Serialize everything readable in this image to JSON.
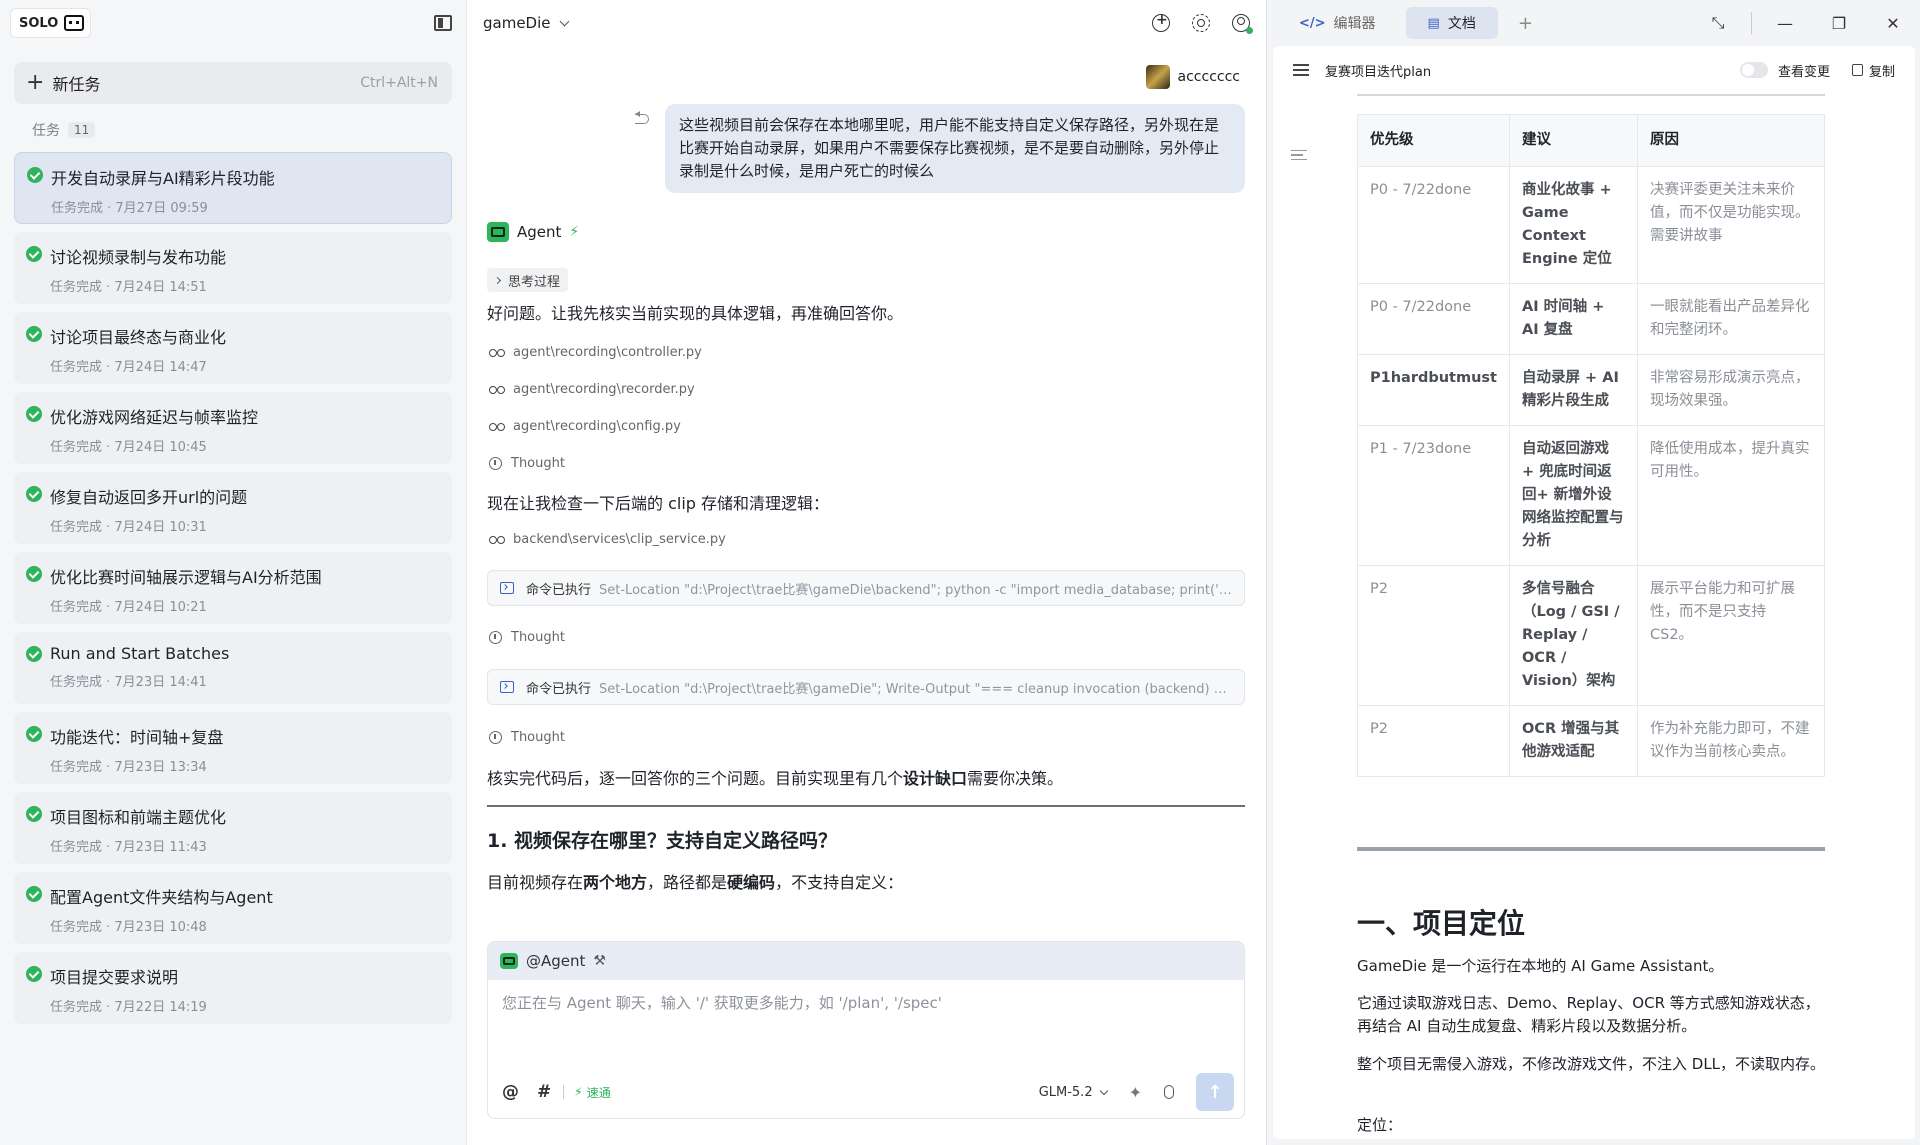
{
  "sidebar": {
    "badge": "SOLO",
    "new_task": {
      "label": "新任务",
      "shortcut": "Ctrl+Alt+N"
    },
    "tasks_label": "任务",
    "tasks_count": "11",
    "tasks": [
      {
        "title": "开发自动录屏与AI精彩片段功能",
        "meta": "任务完成 · 7月27日 09:59",
        "active": true
      },
      {
        "title": "讨论视频录制与发布功能",
        "meta": "任务完成 · 7月24日 14:51"
      },
      {
        "title": "讨论项目最终态与商业化",
        "meta": "任务完成 · 7月24日 14:47"
      },
      {
        "title": "优化游戏网络延迟与帧率监控",
        "meta": "任务完成 · 7月24日 10:45"
      },
      {
        "title": "修复自动返回多开url的问题",
        "meta": "任务完成 · 7月24日 10:31"
      },
      {
        "title": "优化比赛时间轴展示逻辑与AI分析范围",
        "meta": "任务完成 · 7月24日 10:21"
      },
      {
        "title": "Run and Start Batches",
        "meta": "任务完成 · 7月23日 14:41"
      },
      {
        "title": "功能迭代：时间轴+复盘",
        "meta": "任务完成 · 7月23日 13:34"
      },
      {
        "title": "项目图标和前端主题优化",
        "meta": "任务完成 · 7月23日 11:43"
      },
      {
        "title": "配置Agent文件夹结构与Agent",
        "meta": "任务完成 · 7月23日 10:48"
      },
      {
        "title": "项目提交要求说明",
        "meta": "任务完成 · 7月22日 14:19"
      }
    ]
  },
  "chat": {
    "project": "gameDie",
    "user": "accccccc",
    "user_message": "这些视频目前会保存在本地哪里呢，用户能不能支持自定义保存路径，另外现在是比赛开始自动录屏，如果用户不需要保存比赛视频，是不是要自动删除，另外停止录制是什么时候，是用户死亡的时候么",
    "agent_name": "Agent",
    "thinking_label": "思考过程",
    "reply_1": "好问题。让我先核实当前实现的具体逻辑，再准确回答你。",
    "files_1": [
      "agent\\recording\\controller.py",
      "agent\\recording\\recorder.py",
      "agent\\recording\\config.py"
    ],
    "thought_label": "Thought",
    "reply_2": "现在让我检查一下后端的 clip 存储和清理逻辑：",
    "file_2": "backend\\services\\clip_service.py",
    "cmd_done_label": "命令已执行",
    "cmd_1": "Set-Location \"d:\\Project\\trae比赛\\gameDie\\backend\"; python -c \"import media_database; print('CLIPS...",
    "cmd_2": "Set-Location \"d:\\Project\\trae比赛\\gameDie\"; Write-Output \"=== cleanup invocation (backend) ===\";...",
    "reply_3_a": "核实完代码后，逐一回答你的三个问题。目前实现里有几个",
    "reply_3_b": "设计缺口",
    "reply_3_c": "需要你决策。",
    "heading_1": "1. 视频保存在哪里？支持自定义路径吗？",
    "reply_4_a": "目前视频存在",
    "reply_4_b": "两个地方",
    "reply_4_c": "，路径都是",
    "reply_4_d": "硬编码",
    "reply_4_e": "，不支持自定义：",
    "input": {
      "mention": "@Agent",
      "placeholder": "您正在与 Agent 聊天，输入 '/' 获取更多能力，如 '/plan', '/spec'",
      "speed": "速通",
      "model": "GLM-5.2"
    }
  },
  "doc": {
    "tab_editor": "编辑器",
    "tab_doc": "文档",
    "title": "复赛项目迭代plan",
    "view_changes": "查看变更",
    "copy": "复制",
    "table": {
      "headers": [
        "优先级",
        "建议",
        "原因"
      ],
      "rows": [
        {
          "priority": "P0 - 7/22done",
          "suggestion": "商业化故事 + Game Context Engine 定位",
          "reason": "决赛评委更关注未来价值，而不仅是功能实现。需要讲故事"
        },
        {
          "priority": "P0 - 7/22done",
          "suggestion": "AI 时间轴 + AI 复盘",
          "reason": "一眼就能看出产品差异化和完整闭环。"
        },
        {
          "priority": "P1hardbutmust",
          "suggestion": "自动录屏 + AI 精彩片段生成",
          "reason": "非常容易形成演示亮点，现场效果强。",
          "strong": true
        },
        {
          "priority": "P1 - 7/23done",
          "suggestion": "自动返回游戏 + 兜底时间返回+ 新增外设网络监控配置与分析",
          "reason": "降低使用成本，提升真实可用性。"
        },
        {
          "priority": "P2",
          "suggestion": "多信号融合（Log / GSI / Replay / OCR / Vision）架构",
          "reason": "展示平台能力和可扩展性，而不是只支持 CS2。"
        },
        {
          "priority": "P2",
          "suggestion": "OCR 增强与其他游戏适配",
          "reason": "作为补充能力即可，不建议作为当前核心卖点。"
        }
      ]
    },
    "h1": "一、项目定位",
    "p1": "GameDie 是一个运行在本地的 AI Game Assistant。",
    "p2": "它通过读取游戏日志、Demo、Replay、OCR 等方式感知游戏状态，再结合 AI 自动生成复盘、精彩片段以及数据分析。",
    "p3": "整个项目无需侵入游戏，不修改游戏文件，不注入 DLL，不读取内存。",
    "p4": "定位："
  },
  "colors": {
    "accent": "#2fb35c",
    "selection": "#dfe6f2",
    "send": "#c9d8f1"
  }
}
